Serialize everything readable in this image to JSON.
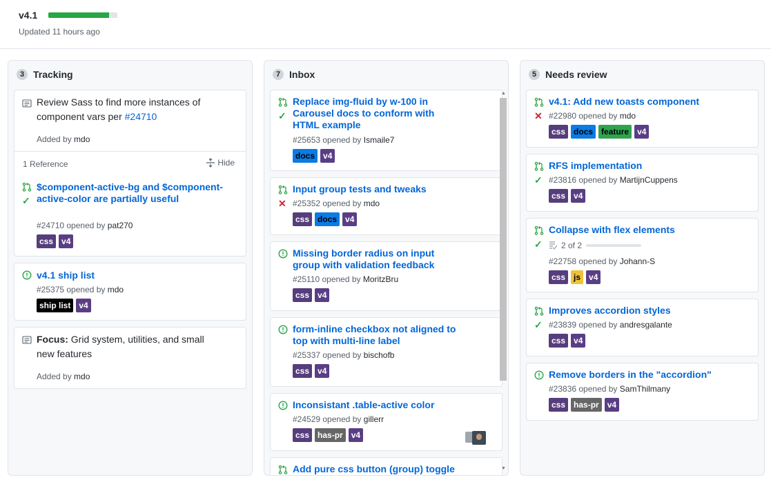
{
  "project": {
    "title": "v4.1",
    "progress": 0.88,
    "updated": "Updated 11 hours ago"
  },
  "colors": {
    "css": "#563d7c",
    "docs": "#0e8a16",
    "feature": "#2ea44f",
    "v4": "#5a3e85",
    "js": "#f0c23b",
    "has_pr": "#666666",
    "ship_list": "#000000",
    "docs_label": "#0b7be5"
  },
  "columns": [
    {
      "name": "Tracking",
      "count": "3",
      "cards": [
        {
          "text": "Review Sass to find more instances of component vars per ",
          "link": "#24710",
          "added": "Added by ",
          "added_by": "mdo",
          "reference_count": "1 Reference",
          "hide": "Hide",
          "ref_title": "$component-active-bg and $component-active-color are partially useful",
          "ref_meta": "#24710 opened by ",
          "ref_author": "pat270",
          "ref_labels": [
            "css",
            "v4"
          ]
        },
        {
          "title": "v4.1 ship list",
          "meta": "#25375 opened by ",
          "author": "mdo",
          "labels": [
            "ship list",
            "v4"
          ]
        },
        {
          "bold": "Focus:",
          "text": " Grid system, utilities, and small new features",
          "added": "Added by ",
          "added_by": "mdo"
        }
      ]
    },
    {
      "name": "Inbox",
      "count": "7",
      "cards": [
        {
          "title": "Replace img-fluid by w-100 in Carousel docs to conform with HTML example",
          "meta": "#25653 opened by ",
          "author": "Ismaile7",
          "labels": [
            "docs",
            "v4"
          ]
        },
        {
          "title": "Input group tests and tweaks",
          "meta": "#25352 opened by ",
          "author": "mdo",
          "labels": [
            "css",
            "docs",
            "v4"
          ]
        },
        {
          "title": "Missing border radius on input group with validation feedback",
          "meta": "#25110 opened by ",
          "author": "MoritzBru",
          "labels": [
            "css",
            "v4"
          ]
        },
        {
          "title": "form-inline checkbox not aligned to top with multi-line label",
          "meta": "#25337 opened by ",
          "author": "bischofb",
          "labels": [
            "css",
            "v4"
          ]
        },
        {
          "title": "Inconsistant .table-active color",
          "meta": "#24529 opened by ",
          "author": "gillerr",
          "labels": [
            "css",
            "has-pr",
            "v4"
          ]
        },
        {
          "title": "Add pure css button (group) toggle"
        }
      ]
    },
    {
      "name": "Needs review",
      "count": "5",
      "cards": [
        {
          "title": "v4.1: Add new toasts component",
          "meta": "#22980 opened by ",
          "author": "mdo",
          "labels": [
            "css",
            "docs",
            "feature",
            "v4"
          ]
        },
        {
          "title": "RFS implementation",
          "meta": "#23816 opened by ",
          "author": "MartijnCuppens",
          "labels": [
            "css",
            "v4"
          ]
        },
        {
          "title": "Collapse with flex elements",
          "tasks": "2 of 2",
          "meta": "#22758 opened by ",
          "author": "Johann-S",
          "labels": [
            "css",
            "js",
            "v4"
          ]
        },
        {
          "title": "Improves accordion styles",
          "meta": "#23839 opened by ",
          "author": "andresgalante",
          "labels": [
            "css",
            "v4"
          ]
        },
        {
          "title": "Remove borders in the \"accordion\"",
          "meta": "#23836 opened by ",
          "author": "SamThilmany",
          "labels": [
            "css",
            "has-pr",
            "v4"
          ]
        }
      ]
    }
  ]
}
